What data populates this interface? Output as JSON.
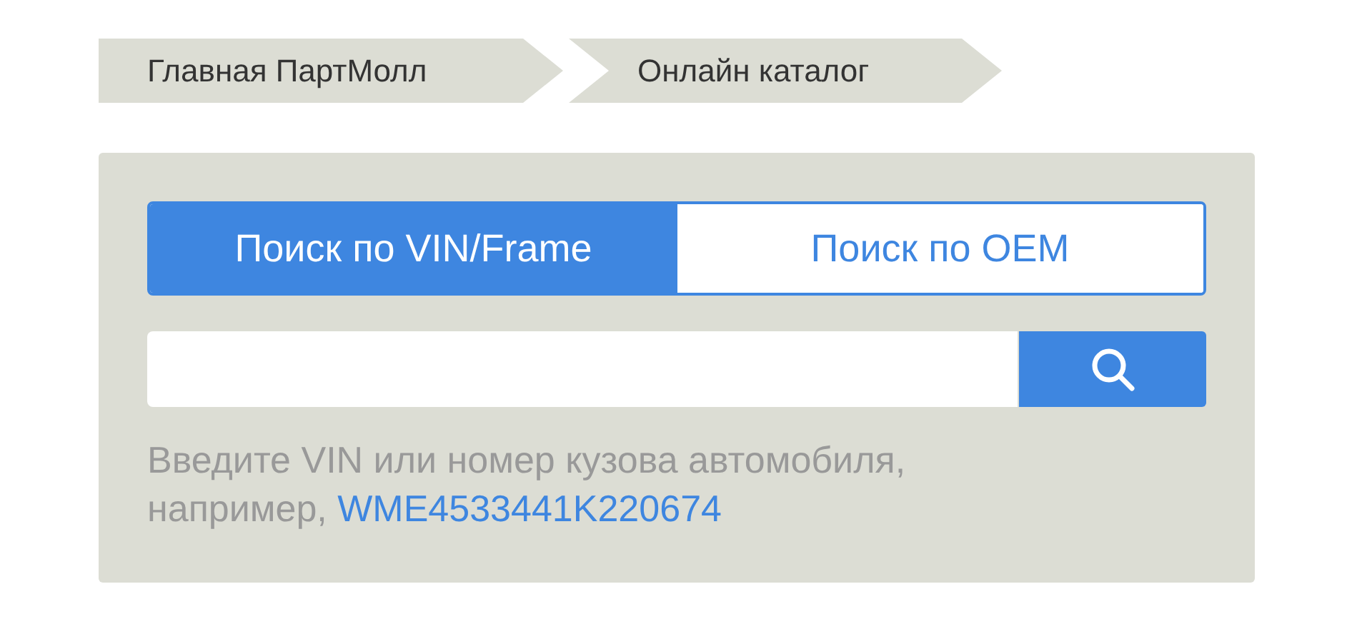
{
  "breadcrumbs": [
    {
      "label": "Главная ПартМолл"
    },
    {
      "label": "Онлайн каталог"
    }
  ],
  "tabs": [
    {
      "label": "Поиск по VIN/Frame",
      "selected": true
    },
    {
      "label": "Поиск по OEM",
      "selected": false
    }
  ],
  "search": {
    "hint": "Введите VIN или номер кузова автомобиля, например,",
    "example": "WME4533441K220674"
  }
}
